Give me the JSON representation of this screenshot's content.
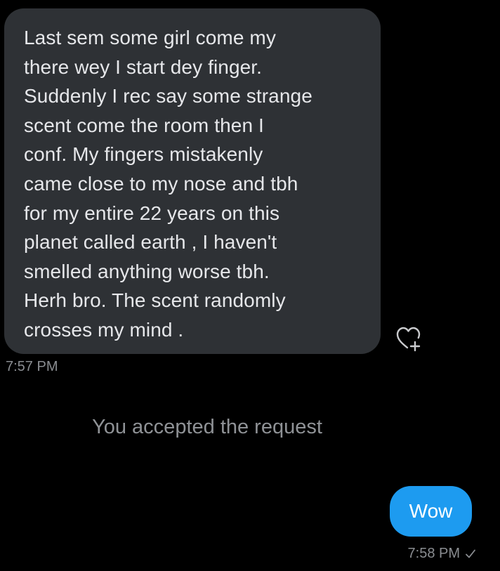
{
  "conversation": {
    "incoming_message": {
      "text": "Last sem some girl come my\nthere wey I start dey finger.\nSuddenly I rec say some strange\nscent come the room then I\nconf. My fingers mistakenly\ncame close to my nose and tbh\nfor my entire 22 years on this\nplanet called earth , I haven't\nsmelled anything worse tbh.\nHerh bro. The scent randomly\ncrosses my mind .",
      "time": "7:57 PM"
    },
    "react_button": {
      "icon": "heart-plus-icon"
    },
    "system_notice": {
      "text": "You accepted the request"
    },
    "outgoing_message": {
      "text": "Wow",
      "time": "7:58 PM",
      "status_icon": "checkmark-icon"
    }
  },
  "colors": {
    "background": "#000000",
    "incoming_bubble": "#2e3135",
    "outgoing_bubble": "#1d9bf0",
    "secondary_text": "#8a8d91"
  }
}
